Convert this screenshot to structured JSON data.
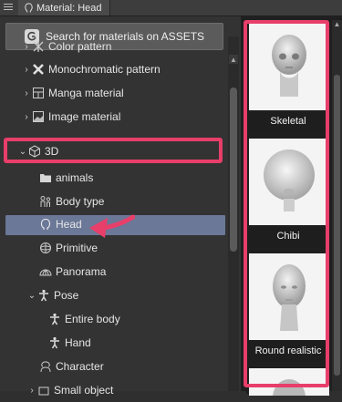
{
  "window": {
    "tab_title": "Material: Head"
  },
  "search": {
    "label": "Search for materials on ASSETS"
  },
  "tree": [
    {
      "label": "Color pattern",
      "chevron": "›",
      "icon": "color-pattern-icon"
    },
    {
      "label": "Monochromatic pattern",
      "chevron": "›",
      "icon": "monochromatic-pattern-icon"
    },
    {
      "label": "Manga material",
      "chevron": "›",
      "icon": "manga-material-icon"
    },
    {
      "label": "Image material",
      "chevron": "›",
      "icon": "image-material-icon"
    },
    {
      "label": "3D",
      "chevron": "⌄",
      "icon": "3d-cube-icon"
    },
    {
      "label": "animals",
      "chevron": "",
      "icon": "folder-icon"
    },
    {
      "label": "Body type",
      "chevron": "",
      "icon": "body-type-icon"
    },
    {
      "label": "Head",
      "chevron": "",
      "icon": "head-icon",
      "selected": true
    },
    {
      "label": "Primitive",
      "chevron": "",
      "icon": "primitive-icon"
    },
    {
      "label": "Panorama",
      "chevron": "",
      "icon": "panorama-icon"
    },
    {
      "label": "Pose",
      "chevron": "⌄",
      "icon": "pose-icon"
    },
    {
      "label": "Entire body",
      "chevron": "",
      "icon": "entire-body-icon"
    },
    {
      "label": "Hand",
      "chevron": "",
      "icon": "hand-icon"
    },
    {
      "label": "Character",
      "chevron": "",
      "icon": "character-icon"
    },
    {
      "label": "Small object",
      "chevron": "›",
      "icon": "small-object-icon"
    }
  ],
  "materials": [
    {
      "label": "Skeletal"
    },
    {
      "label": "Chibi"
    },
    {
      "label": "Round realistic"
    }
  ],
  "colors": {
    "highlight": "#e83e6a",
    "selected": "#6b7897"
  }
}
